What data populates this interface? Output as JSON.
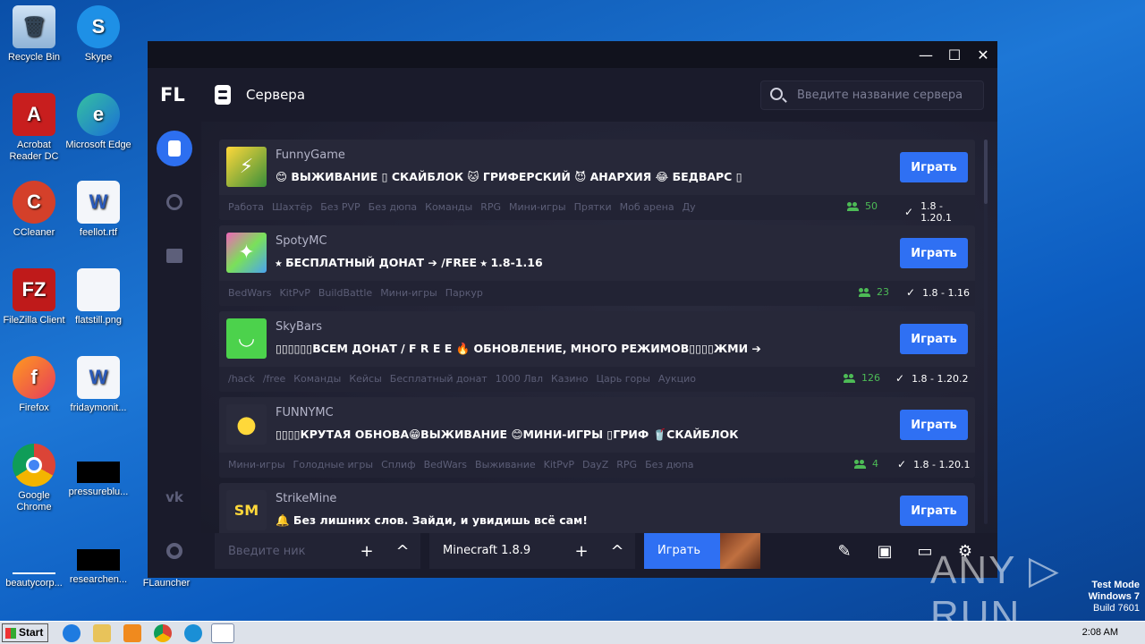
{
  "desktop": {
    "icons": [
      {
        "label": "Recycle Bin"
      },
      {
        "label": "Skype"
      },
      {
        "label": "Acrobat Reader DC"
      },
      {
        "label": "Microsoft Edge"
      },
      {
        "label": "CCleaner"
      },
      {
        "label": "feellot.rtf"
      },
      {
        "label": "FileZilla Client"
      },
      {
        "label": "flatstill.png"
      },
      {
        "label": "Firefox"
      },
      {
        "label": "fridaymonit..."
      },
      {
        "label": "Google Chrome"
      },
      {
        "label": "pressureblu..."
      },
      {
        "label": "beautycorp..."
      },
      {
        "label": "researchen..."
      },
      {
        "label": "FLauncher"
      }
    ]
  },
  "window": {
    "minimize": "—",
    "maximize": "☐",
    "close": "✕"
  },
  "sidebar": {
    "logo": "FL"
  },
  "header": {
    "title": "Сервера",
    "search_placeholder": "Введите название сервера"
  },
  "servers": [
    {
      "name": "FunnyGame",
      "motd": "😊 ВЫЖИВАНИЕ ▯ СКАЙБЛОК 🐱 ГРИФЕРСКИЙ 😈 АНАРХИЯ 😂 БЕДВАРС ▯",
      "tags": [
        "Работа",
        "Шахтёр",
        "Без PVP",
        "Без дюпа",
        "Команды",
        "RPG",
        "Мини-игры",
        "Прятки",
        "Моб арена",
        "Ду"
      ],
      "online": "50",
      "version": "1.8 - 1.20.1",
      "play": "Играть"
    },
    {
      "name": "SpotyMC",
      "motd": "⭑ БЕСПЛАТНЫЙ ДОНАТ ➔ /FREE ⭑ 1.8-1.16",
      "tags": [
        "BedWars",
        "KitPvP",
        "BuildBattle",
        "Мини-игры",
        "Паркур"
      ],
      "online": "23",
      "version": "1.8 - 1.16",
      "play": "Играть"
    },
    {
      "name": "SkyBars",
      "motd": "▯▯▯▯▯▯ВСЕМ ДОНАТ / F R E E 🔥 ОБНОВЛЕНИЕ, МНОГО РЕЖИМОВ▯▯▯▯ЖМИ ➔",
      "tags": [
        "/hack",
        "/free",
        "Команды",
        "Кейсы",
        "Бесплатный донат",
        "1000 Лвл",
        "Казино",
        "Царь горы",
        "Аукцио"
      ],
      "online": "126",
      "version": "1.8 - 1.20.2",
      "play": "Играть"
    },
    {
      "name": "FUNNYMC",
      "motd": "▯▯▯▯КРУТАЯ ОБНОВА😁ВЫЖИВАНИЕ 😊МИНИ-ИГРЫ ▯ГРИФ 🥤СКАЙБЛОК",
      "tags": [
        "Мини-игры",
        "Голодные игры",
        "Сплиф",
        "BedWars",
        "Выживание",
        "KitPvP",
        "DayZ",
        "RPG",
        "Без дюпа"
      ],
      "online": "4",
      "version": "1.8 - 1.20.1",
      "play": "Играть"
    },
    {
      "name": "StrikeMine",
      "motd": "🔔 Без лишних слов. Зайди, и увидишь всё сам!",
      "tags": [],
      "online": "",
      "version": "",
      "play": "Играть"
    }
  ],
  "bottom": {
    "nick_placeholder": "Введите ник",
    "plus": "+",
    "chevron": "^",
    "version": "Minecraft 1.8.9",
    "play": "Играть"
  },
  "taskbar": {
    "start": "Start",
    "time": "2:08 AM"
  },
  "watermark": {
    "line1": "Test Mode",
    "line2": "Windows 7",
    "line3": "Build 7601",
    "brand": "ANY ▷ RUN"
  },
  "colors": {
    "accent": "#2f70f3",
    "online": "#4dbb56",
    "window_bg": "#1a1b2b",
    "card_bg": "#272839"
  }
}
